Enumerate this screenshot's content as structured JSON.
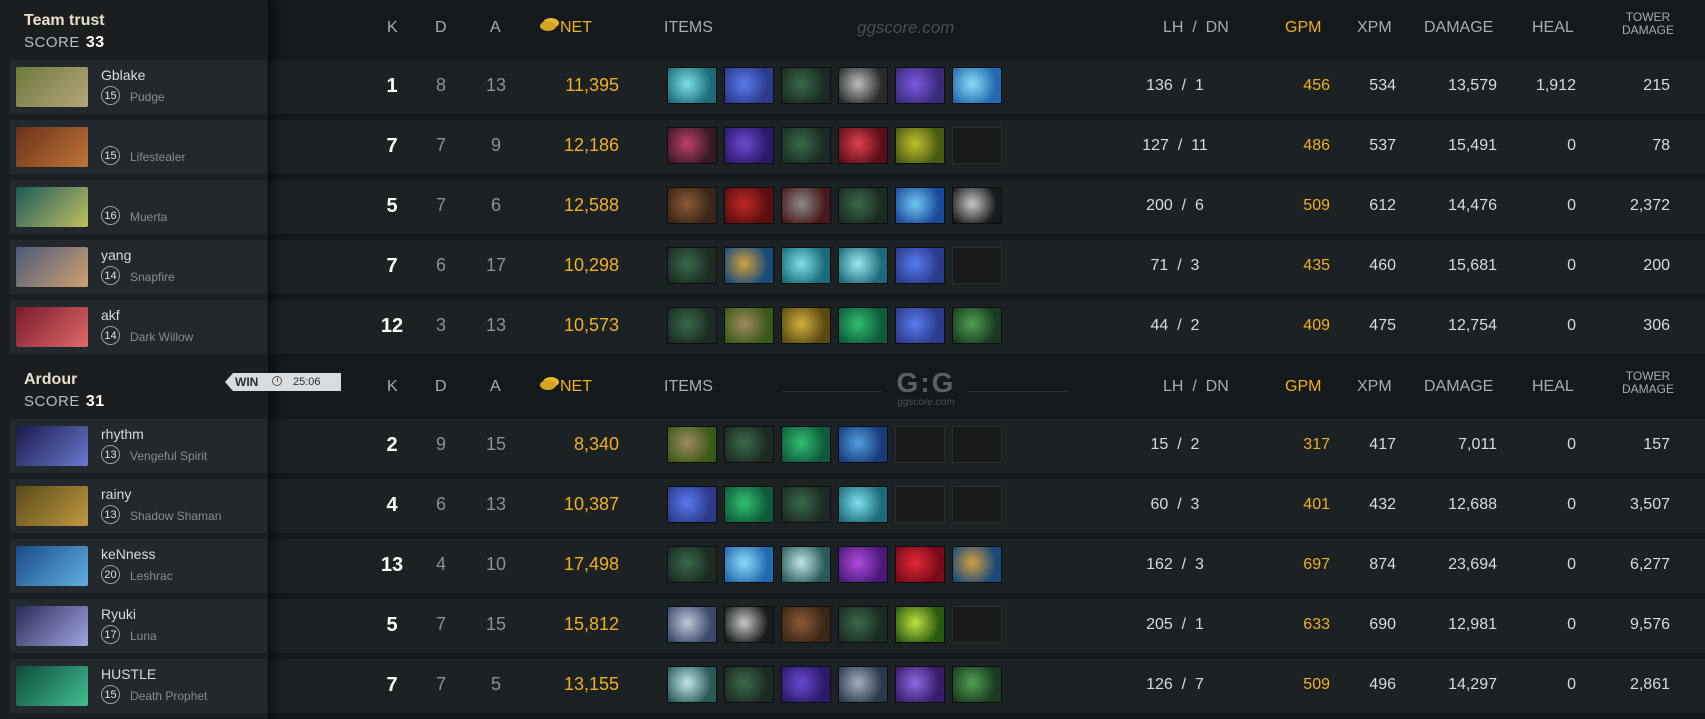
{
  "watermark": "ggscore.com",
  "logo": {
    "big": "G:G",
    "small": "ggscore.com"
  },
  "headers": {
    "k": "K",
    "d": "D",
    "a": "A",
    "net": "NET",
    "items": "ITEMS",
    "lhdn": "LH  /  DN",
    "gpm": "GPM",
    "xpm": "XPM",
    "damage": "DAMAGE",
    "heal": "HEAL",
    "tower": "TOWER DAMAGE"
  },
  "colors": {
    "gold": "#f0b020",
    "panel": "#1a1e21",
    "row": "#1c2124"
  },
  "match": {
    "result": "WIN",
    "duration": "25:06"
  },
  "teams": [
    {
      "name": "Team trust",
      "score_label": "SCORE",
      "score": "33",
      "players": [
        {
          "name": "Gblake",
          "level": "15",
          "hero": "Pudge",
          "k": "1",
          "d": "8",
          "a": "13",
          "net": "11,395",
          "lhdn": "136  /  1",
          "gpm": "456",
          "xpm": "534",
          "damage": "13,579",
          "heal": "1,912",
          "tower": "215",
          "avatar": [
            "#6b7a3a",
            "#b9a67a"
          ],
          "items": [
            [
              "#1d6a7a",
              "#7be0ea"
            ],
            [
              "#2b3a8a",
              "#5a7aee"
            ],
            [
              "#1b2a22",
              "#3a6a48"
            ],
            [
              "#2a2a2a",
              "#bdbdbd"
            ],
            [
              "#3a2a7a",
              "#7a5ae0"
            ],
            [
              "#1f6ab0",
              "#8cdcf8"
            ]
          ]
        },
        {
          "name": "",
          "level": "15",
          "hero": "Lifestealer",
          "k": "7",
          "d": "7",
          "a": "9",
          "net": "12,186",
          "lhdn": "127  /  11",
          "gpm": "486",
          "xpm": "537",
          "damage": "15,491",
          "heal": "0",
          "tower": "78",
          "avatar": [
            "#6a3318",
            "#c07438"
          ],
          "items": [
            [
              "#3a1a22",
              "#c04070"
            ],
            [
              "#2a1a6a",
              "#6a4ad0"
            ],
            [
              "#1b2a22",
              "#3a6a48"
            ],
            [
              "#5a0e18",
              "#e04050"
            ],
            [
              "#4a5a10",
              "#c0c030"
            ],
            null
          ]
        },
        {
          "name": "",
          "level": "16",
          "hero": "Muerta",
          "k": "5",
          "d": "7",
          "a": "6",
          "net": "12,588",
          "lhdn": "200  /  6",
          "gpm": "509",
          "xpm": "612",
          "damage": "14,476",
          "heal": "0",
          "tower": "2,372",
          "avatar": [
            "#1c5a5a",
            "#c0c060"
          ],
          "items": [
            [
              "#3a2516",
              "#8a5a36"
            ],
            [
              "#5a0e0e",
              "#c02828"
            ],
            [
              "#4a1a1a",
              "#8a8a8a"
            ],
            [
              "#1b2a22",
              "#3a6a48"
            ],
            [
              "#1a4aa0",
              "#70c8f0"
            ],
            [
              "#1a1a1a",
              "#c8c8c8"
            ]
          ]
        },
        {
          "name": "yang",
          "level": "14",
          "hero": "Snapfire",
          "k": "7",
          "d": "6",
          "a": "17",
          "net": "10,298",
          "lhdn": "71  /  3",
          "gpm": "435",
          "xpm": "460",
          "damage": "15,681",
          "heal": "0",
          "tower": "200",
          "avatar": [
            "#4a5a7a",
            "#d0a070"
          ],
          "items": [
            [
              "#1b2a22",
              "#3a6a48"
            ],
            [
              "#1a4a7a",
              "#d0a040"
            ],
            [
              "#1d6a7a",
              "#7be0ea"
            ],
            [
              "#1d6a7a",
              "#9be8f0"
            ],
            [
              "#2b3a8a",
              "#5a7aee"
            ],
            null
          ]
        },
        {
          "name": "akf",
          "level": "14",
          "hero": "Dark Willow",
          "k": "12",
          "d": "3",
          "a": "13",
          "net": "10,573",
          "lhdn": "44  /  2",
          "gpm": "409",
          "xpm": "475",
          "damage": "12,754",
          "heal": "0",
          "tower": "306",
          "avatar": [
            "#7a1a2a",
            "#e06a6a"
          ],
          "items": [
            [
              "#1b2a22",
              "#3a6a48"
            ],
            [
              "#3a5a1a",
              "#a08a5a"
            ],
            [
              "#5a4a10",
              "#d0b040"
            ],
            [
              "#0e5a3a",
              "#30c070"
            ],
            [
              "#2b3a8a",
              "#5a7aee"
            ],
            [
              "#1a3a22",
              "#50a050"
            ]
          ]
        }
      ]
    },
    {
      "name": "Ardour",
      "score_label": "SCORE",
      "score": "31",
      "players": [
        {
          "name": "rhythm",
          "level": "13",
          "hero": "Vengeful Spirit",
          "k": "2",
          "d": "9",
          "a": "15",
          "net": "8,340",
          "lhdn": "15  /  2",
          "gpm": "317",
          "xpm": "417",
          "damage": "7,011",
          "heal": "0",
          "tower": "157",
          "avatar": [
            "#1a1a4a",
            "#6a7ad0"
          ],
          "items": [
            [
              "#3a5a1a",
              "#a08a5a"
            ],
            [
              "#1b2a22",
              "#3a6a48"
            ],
            [
              "#0e5a3a",
              "#30c070"
            ],
            [
              "#1a3a7a",
              "#50a0e0"
            ],
            null,
            null
          ]
        },
        {
          "name": "rainy",
          "level": "13",
          "hero": "Shadow Shaman",
          "k": "4",
          "d": "6",
          "a": "13",
          "net": "10,387",
          "lhdn": "60  /  3",
          "gpm": "401",
          "xpm": "432",
          "damage": "12,688",
          "heal": "0",
          "tower": "3,507",
          "avatar": [
            "#5a4a1a",
            "#c09a40"
          ],
          "items": [
            [
              "#2b3a8a",
              "#5a7aee"
            ],
            [
              "#0e5a3a",
              "#30c070"
            ],
            [
              "#1b2a22",
              "#3a6a48"
            ],
            [
              "#1d6a7a",
              "#7be0ea"
            ],
            null,
            null
          ]
        },
        {
          "name": "keNness",
          "level": "20",
          "hero": "Leshrac",
          "k": "13",
          "d": "4",
          "a": "10",
          "net": "17,498",
          "lhdn": "162  /  3",
          "gpm": "697",
          "xpm": "874",
          "damage": "23,694",
          "heal": "0",
          "tower": "6,277",
          "avatar": [
            "#1a4a8a",
            "#60b0e0"
          ],
          "items": [
            [
              "#1b2a22",
              "#3a6a48"
            ],
            [
              "#1f6ab0",
              "#8cdcf8"
            ],
            [
              "#2a5a5a",
              "#c0e8e8"
            ],
            [
              "#4a1a7a",
              "#b04ae0"
            ],
            [
              "#7a0a1a",
              "#e02838"
            ],
            [
              "#1a4a7a",
              "#d0a040"
            ]
          ]
        },
        {
          "name": "Ryuki",
          "level": "17",
          "hero": "Luna",
          "k": "5",
          "d": "7",
          "a": "15",
          "net": "15,812",
          "lhdn": "205  /  1",
          "gpm": "633",
          "xpm": "690",
          "damage": "12,981",
          "heal": "0",
          "tower": "9,576",
          "avatar": [
            "#2a2a5a",
            "#a0a8e0"
          ],
          "items": [
            [
              "#3a4a6a",
              "#c0c8d8"
            ],
            [
              "#1a1a1a",
              "#c8c8c8"
            ],
            [
              "#3a2516",
              "#8a5a36"
            ],
            [
              "#1b2a22",
              "#3a6a48"
            ],
            [
              "#2a5a10",
              "#c0e040"
            ],
            null
          ]
        },
        {
          "name": "HUSTLE",
          "level": "15",
          "hero": "Death Prophet",
          "k": "7",
          "d": "7",
          "a": "5",
          "net": "13,155",
          "lhdn": "126  /  7",
          "gpm": "509",
          "xpm": "496",
          "damage": "14,297",
          "heal": "0",
          "tower": "2,861",
          "avatar": [
            "#0e4a3a",
            "#40c090"
          ],
          "items": [
            [
              "#2a5a5a",
              "#c0e8e8"
            ],
            [
              "#1b2a22",
              "#3a6a48"
            ],
            [
              "#2a1a6a",
              "#6a4ad0"
            ],
            [
              "#2a3a4a",
              "#a0b0c0"
            ],
            [
              "#3a1a6a",
              "#8a6ae0"
            ],
            [
              "#1a3a22",
              "#50a050"
            ]
          ]
        }
      ]
    }
  ]
}
